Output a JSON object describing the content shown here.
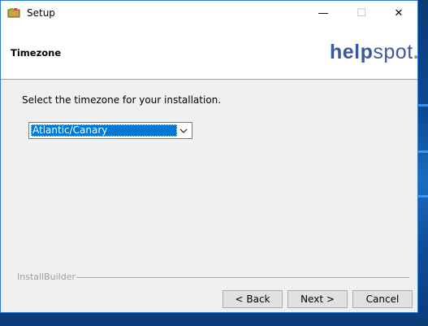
{
  "window": {
    "title": "Setup",
    "minimize_glyph": "—",
    "maximize_glyph": "☐",
    "close_glyph": "✕"
  },
  "header": {
    "page_title": "Timezone",
    "logo_help": "help",
    "logo_spot": "spot",
    "logo_dot": ".",
    "logo_color": "#3b5a9a",
    "logo_dot_color": "#5cb85c"
  },
  "content": {
    "instruction": "Select the timezone for your installation.",
    "timezone_select": {
      "selected": "Atlantic/Canary"
    }
  },
  "footer": {
    "brand": "InstallBuilder",
    "back_label": "< Back",
    "next_label": "Next >",
    "cancel_label": "Cancel"
  },
  "colors": {
    "selection": "#0078d7",
    "window_border": "#2b79d6"
  }
}
